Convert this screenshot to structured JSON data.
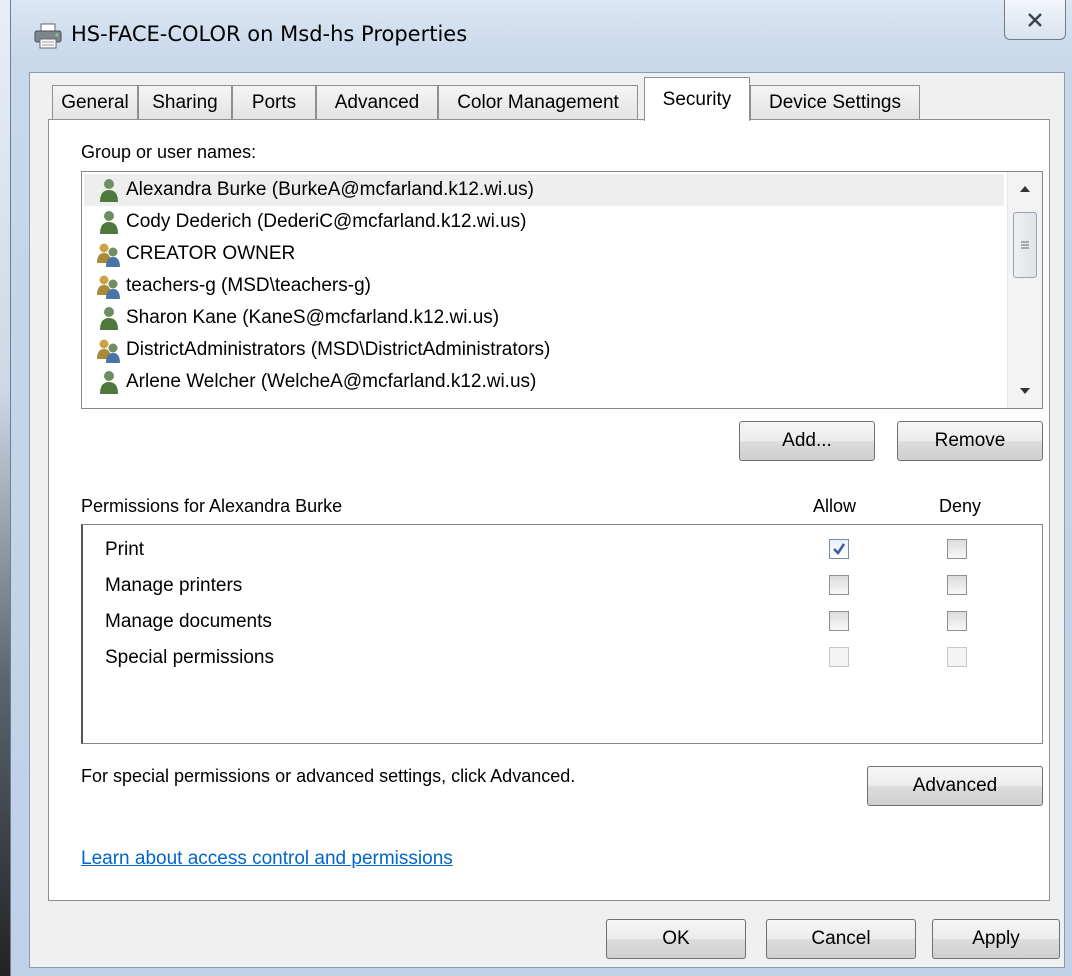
{
  "window": {
    "title": "HS-FACE-COLOR on Msd-hs Properties"
  },
  "tabs": [
    {
      "label": "General"
    },
    {
      "label": "Sharing"
    },
    {
      "label": "Ports"
    },
    {
      "label": "Advanced"
    },
    {
      "label": "Color Management"
    },
    {
      "label": "Security"
    },
    {
      "label": "Device Settings"
    }
  ],
  "active_tab": "Security",
  "group_list": {
    "label": "Group or user names:",
    "items": [
      {
        "text": "Alexandra Burke (BurkeA@mcfarland.k12.wi.us)",
        "icon": "user-icon",
        "selected": true
      },
      {
        "text": "Cody Dederich (DederiC@mcfarland.k12.wi.us)",
        "icon": "user-icon",
        "selected": false
      },
      {
        "text": "CREATOR OWNER",
        "icon": "group-icon",
        "selected": false
      },
      {
        "text": "teachers-g (MSD\\teachers-g)",
        "icon": "group-icon",
        "selected": false
      },
      {
        "text": "Sharon Kane (KaneS@mcfarland.k12.wi.us)",
        "icon": "user-icon",
        "selected": false
      },
      {
        "text": "DistrictAdministrators (MSD\\DistrictAdministrators)",
        "icon": "group-icon",
        "selected": false
      },
      {
        "text": "Arlene Welcher (WelcheA@mcfarland.k12.wi.us)",
        "icon": "user-icon",
        "selected": false
      }
    ]
  },
  "buttons": {
    "add": "Add...",
    "remove": "Remove",
    "advanced": "Advanced",
    "ok": "OK",
    "cancel": "Cancel",
    "apply": "Apply"
  },
  "permissions": {
    "label": "Permissions for Alexandra Burke",
    "allow_header": "Allow",
    "deny_header": "Deny",
    "rows": [
      {
        "name": "Print",
        "allow": true,
        "deny": false,
        "enabled": true
      },
      {
        "name": "Manage printers",
        "allow": false,
        "deny": false,
        "enabled": true
      },
      {
        "name": "Manage documents",
        "allow": false,
        "deny": false,
        "enabled": true
      },
      {
        "name": "Special permissions",
        "allow": false,
        "deny": false,
        "enabled": false
      }
    ]
  },
  "advanced_hint": "For special permissions or advanced settings, click Advanced.",
  "help_link": "Learn about access control and permissions",
  "colors": {
    "link": "#0066cc",
    "selection": "#eeeeee",
    "client_bg": "#f0f0f0"
  }
}
